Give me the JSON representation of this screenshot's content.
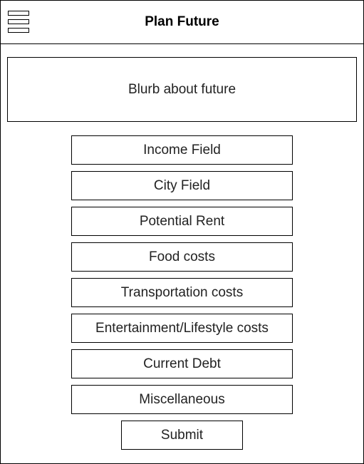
{
  "header": {
    "title": "Plan Future",
    "menu_icon": "hamburger-menu-icon"
  },
  "blurb": {
    "text": "Blurb about future"
  },
  "form": {
    "fields": [
      {
        "label": "Income Field"
      },
      {
        "label": "City Field"
      },
      {
        "label": "Potential Rent"
      },
      {
        "label": "Food costs"
      },
      {
        "label": "Transportation costs"
      },
      {
        "label": "Entertainment/Lifestyle costs"
      },
      {
        "label": "Current Debt"
      },
      {
        "label": "Miscellaneous"
      }
    ],
    "submit_label": "Submit"
  },
  "colors": {
    "border": "#000000",
    "text": "#222222",
    "background": "#ffffff"
  }
}
